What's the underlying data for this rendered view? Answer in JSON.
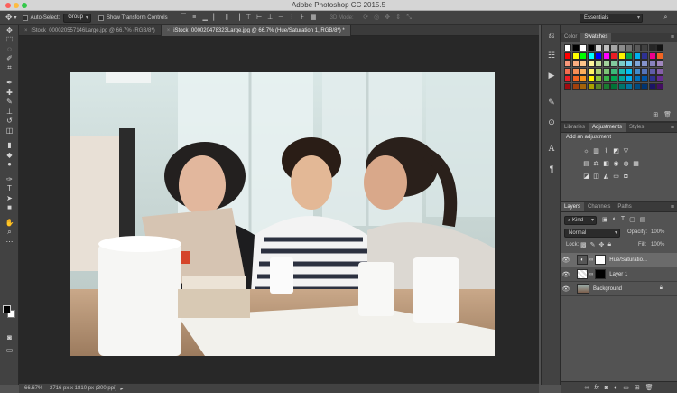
{
  "window": {
    "title": "Adobe Photoshop CC 2015.5",
    "traffic_lights": [
      "#fc605c",
      "#fdbc40",
      "#34c84a"
    ]
  },
  "options_bar": {
    "auto_select_label": "Auto-Select:",
    "auto_select_value": "Group",
    "show_transform_label": "Show Transform Controls",
    "mode_3d_label": "3D Mode:",
    "workspace_value": "Essentials"
  },
  "tools": [
    "move-icon",
    "marquee-icon",
    "lasso-icon",
    "quick-select-icon",
    "crop-icon",
    "eyedropper-icon",
    "healing-brush-icon",
    "brush-icon",
    "clone-stamp-icon",
    "history-brush-icon",
    "eraser-icon",
    "gradient-icon",
    "blur-icon",
    "dodge-icon",
    "pen-icon",
    "type-icon",
    "path-select-icon",
    "rectangle-icon",
    "hand-icon",
    "zoom-icon",
    "edit-toolbar-icon"
  ],
  "tabs": [
    {
      "label": "iStock_000020557146Large.jpg @ 66.7% (RGB/8*)",
      "active": false
    },
    {
      "label": "iStock_000020478323Large.jpg @ 66.7% (Hue/Saturation 1, RGB/8*) *",
      "active": true
    }
  ],
  "status_bar": {
    "zoom": "66.67%",
    "doc_info": "2716 px x 1810 px (300 ppi)"
  },
  "panels": {
    "color_tabs": [
      "Color",
      "Swatches"
    ],
    "color_active": "Swatches",
    "adjust_tabs": [
      "Libraries",
      "Adjustments",
      "Styles"
    ],
    "adjust_active": "Adjustments",
    "add_adjustment": "Add an adjustment",
    "layers_tabs": [
      "Layers",
      "Channels",
      "Paths"
    ],
    "layers_active": "Layers",
    "filter_kind": "Kind",
    "blend_mode": "Normal",
    "opacity_label": "Opacity:",
    "opacity_value": "100%",
    "lock_label": "Lock:",
    "fill_label": "Fill:",
    "fill_value": "100%",
    "layers": [
      {
        "name": "Hue/Saturatio...",
        "selected": true
      },
      {
        "name": "Layer 1",
        "selected": false
      },
      {
        "name": "Background",
        "selected": false
      }
    ]
  },
  "swatches": [
    "#ffffff",
    "#000000",
    "#ffffff",
    "#000000",
    "#d9d9d9",
    "#bfbfbf",
    "#a6a6a6",
    "#8c8c8c",
    "#737373",
    "#595959",
    "#404040",
    "#262626",
    "#131313",
    "#ff0000",
    "#ffff00",
    "#00ff00",
    "#00ffff",
    "#0000ff",
    "#ff00ff",
    "#ed1c24",
    "#fff200",
    "#00a651",
    "#00aeef",
    "#2e3192",
    "#ec008c",
    "#f26522",
    "#f7977a",
    "#f9ad81",
    "#fdc68a",
    "#fff79a",
    "#c4df9b",
    "#a3d39c",
    "#82ca9d",
    "#7bcdc8",
    "#6ecff6",
    "#7ea7d8",
    "#8493ca",
    "#8882be",
    "#a187be",
    "#f26c4f",
    "#f68e55",
    "#fbaf5c",
    "#fff467",
    "#acd372",
    "#7cc576",
    "#3bb878",
    "#1abbb4",
    "#00bff3",
    "#438ccb",
    "#5574b9",
    "#605ca8",
    "#855fa8",
    "#ed1c24",
    "#f26522",
    "#f7941d",
    "#fff200",
    "#8dc63f",
    "#39b54a",
    "#00a651",
    "#00a99d",
    "#00aeef",
    "#0072bc",
    "#0054a6",
    "#2e3192",
    "#662d91",
    "#9e0b0f",
    "#a0410d",
    "#a36209",
    "#aba000",
    "#598527",
    "#1a7b30",
    "#007236",
    "#00746b",
    "#0076a3",
    "#004b80",
    "#003471",
    "#1b1464",
    "#440e62"
  ]
}
